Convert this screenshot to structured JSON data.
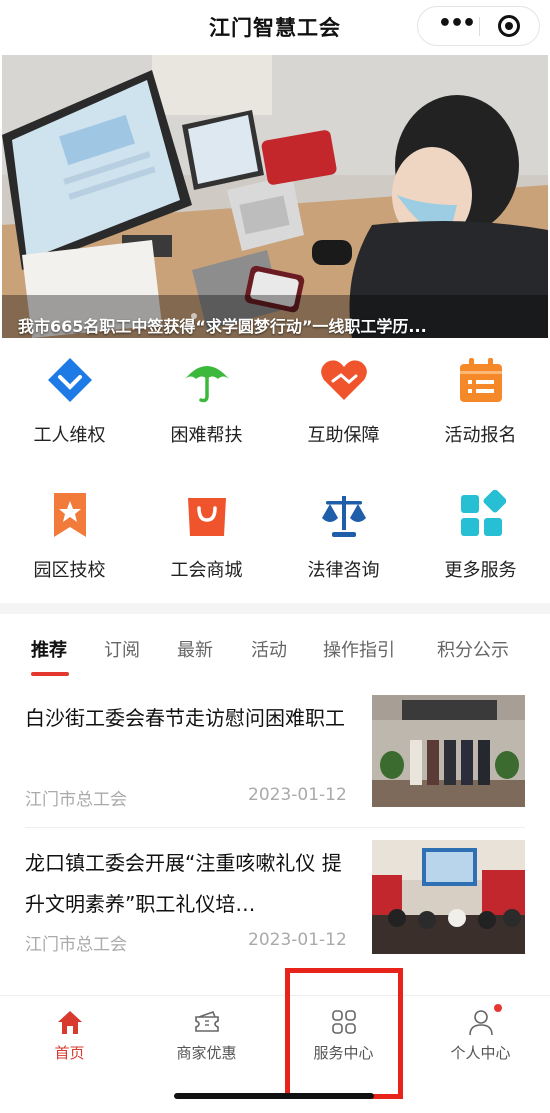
{
  "header": {
    "title": "江门智慧工会",
    "more_icon": "more-dots-icon",
    "close_icon": "target-circle-icon"
  },
  "banner": {
    "caption": "我市665名职工中签获得“求学圆梦行动”一线职工学历..."
  },
  "services": [
    {
      "label": "工人维权",
      "icon": "diamond-shield-icon",
      "color": "#1e7be6"
    },
    {
      "label": "困难帮扶",
      "icon": "umbrella-icon",
      "color": "#3cb83c"
    },
    {
      "label": "互助保障",
      "icon": "heart-hand-icon",
      "color": "#f0542d"
    },
    {
      "label": "活动报名",
      "icon": "calendar-list-icon",
      "color": "#f5892a"
    },
    {
      "label": "园区技校",
      "icon": "bookmark-star-icon",
      "color": "#f27a3b"
    },
    {
      "label": "工会商城",
      "icon": "shopping-bag-icon",
      "color": "#f0542d"
    },
    {
      "label": "法律咨询",
      "icon": "scales-icon",
      "color": "#1f5ea8"
    },
    {
      "label": "更多服务",
      "icon": "grid-more-icon",
      "color": "#26bfd3"
    }
  ],
  "tabs": [
    "推荐",
    "订阅",
    "最新",
    "活动",
    "操作指引",
    "积分公示"
  ],
  "articles": [
    {
      "title": "白沙街工委会春节走访慰问困难职工",
      "source": "江门市总工会",
      "date": "2023-01-12"
    },
    {
      "title": "龙口镇工委会开展“注重咳嗽礼仪 提升文明素养”职工礼仪培…",
      "source": "江门市总工会",
      "date": "2023-01-12"
    }
  ],
  "bottom_nav": [
    {
      "label": "首页",
      "icon": "home-icon",
      "active": true
    },
    {
      "label": "商家优惠",
      "icon": "coupon-icon",
      "active": false
    },
    {
      "label": "服务中心",
      "icon": "four-squares-icon",
      "active": false
    },
    {
      "label": "个人中心",
      "icon": "person-icon",
      "active": false
    }
  ],
  "colors": {
    "accent": "#e4382f",
    "active_nav": "#d83a2f",
    "highlight": "#e8231a"
  }
}
